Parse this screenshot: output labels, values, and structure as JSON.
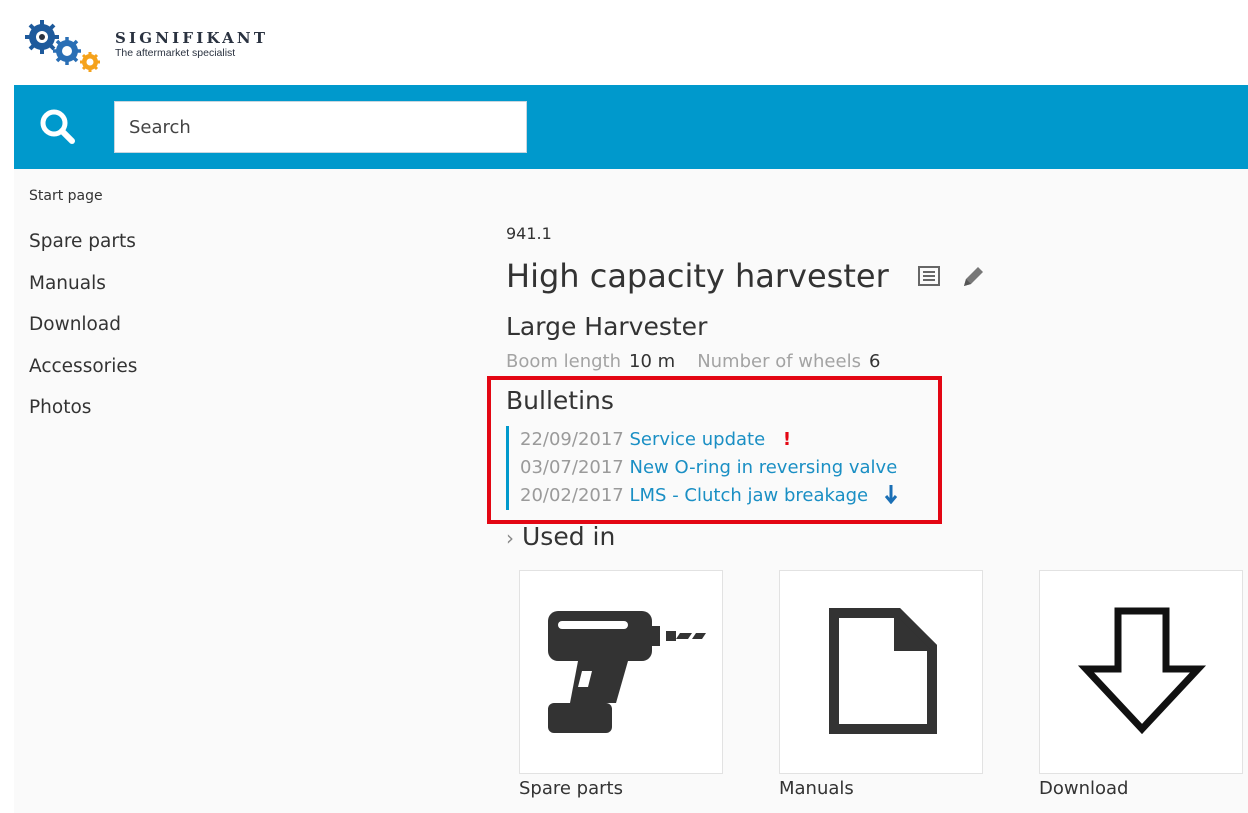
{
  "brand": {
    "name": "SIGNIFIKANT",
    "tagline": "The aftermarket specialist"
  },
  "search": {
    "placeholder": "Search"
  },
  "sidebar": {
    "breadcrumb": "Start page",
    "items": [
      {
        "label": "Spare parts"
      },
      {
        "label": "Manuals"
      },
      {
        "label": "Download"
      },
      {
        "label": "Accessories"
      },
      {
        "label": "Photos"
      }
    ]
  },
  "product": {
    "number": "941.1",
    "title": "High capacity harvester",
    "subtitle": "Large Harvester",
    "attributes": [
      {
        "label": "Boom length",
        "value": "10 m"
      },
      {
        "label": "Number of wheels",
        "value": "6"
      }
    ]
  },
  "bulletins": {
    "title": "Bulletins",
    "items": [
      {
        "date": "22/09/2017",
        "title": "Service update",
        "flag": "!"
      },
      {
        "date": "03/07/2017",
        "title": "New O-ring in reversing valve"
      },
      {
        "date": "20/02/2017",
        "title": "LMS - Clutch jaw breakage",
        "icon": "download-arrow-icon"
      }
    ]
  },
  "used_in": {
    "title": "Used in",
    "tiles": [
      {
        "label": "Spare parts",
        "icon": "drill-icon"
      },
      {
        "label": "Manuals",
        "icon": "document-icon"
      },
      {
        "label": "Download",
        "icon": "download-icon"
      }
    ]
  },
  "colors": {
    "accent": "#0099cc",
    "highlight_border": "#e30613",
    "link": "#1a8fc4"
  }
}
